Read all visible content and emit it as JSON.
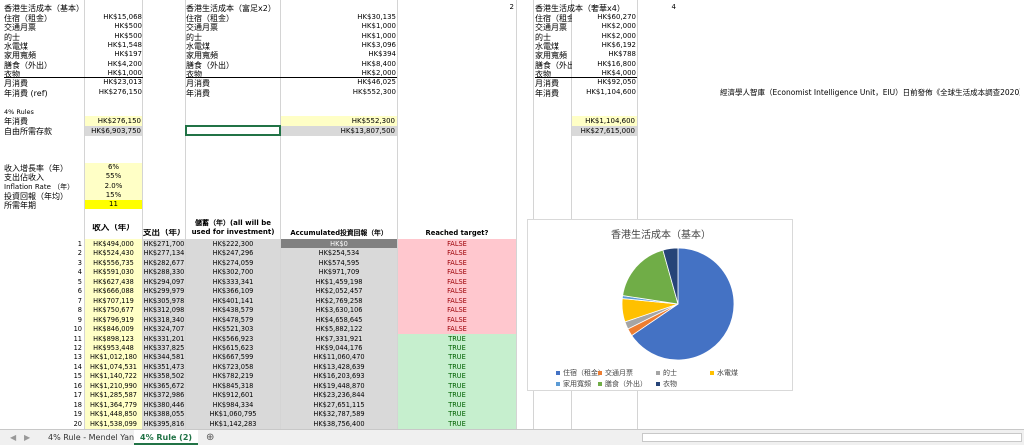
{
  "sheet": {
    "basic": {
      "title": "香港生活成本（基本）",
      "rows": [
        {
          "label": "住宿（租金）",
          "value": "HK$15,068"
        },
        {
          "label": "交通月票",
          "value": "HK$500"
        },
        {
          "label": "的士",
          "value": "HK$500"
        },
        {
          "label": "水電煤",
          "value": "HK$1,548"
        },
        {
          "label": "家用寬頻",
          "value": "HK$197"
        },
        {
          "label": "膳食（外出）",
          "value": "HK$4,200"
        },
        {
          "label": "衣物",
          "value": "HK$1,000"
        }
      ],
      "monthly_label": "月消費",
      "monthly_value": "HK$23,013",
      "yearly_label": "年消費 (ref)",
      "yearly_value": "HK$276,150"
    },
    "rich": {
      "title": "香港生活成本（富足x2）",
      "multiplier": "2",
      "rows": [
        {
          "label": "住宿（租金）",
          "value": "HK$30,135"
        },
        {
          "label": "交通月票",
          "value": "HK$1,000"
        },
        {
          "label": "的士",
          "value": "HK$1,000"
        },
        {
          "label": "水電煤",
          "value": "HK$3,096"
        },
        {
          "label": "家用寬頻",
          "value": "HK$394"
        },
        {
          "label": "膳食（外出）",
          "value": "HK$8,400"
        },
        {
          "label": "衣物",
          "value": "HK$2,000"
        }
      ],
      "monthly_label": "月消費",
      "monthly_value": "HK$46,025",
      "yearly_label": "年消費",
      "yearly_value": "HK$552,300"
    },
    "luxury": {
      "title": "香港生活成本（奢華x4）",
      "multiplier": "4",
      "rows": [
        {
          "label": "住宿（租金",
          "value": "HK$60,270"
        },
        {
          "label": "交通月票",
          "value": "HK$2,000"
        },
        {
          "label": "的士",
          "value": "HK$2,000"
        },
        {
          "label": "水電煤",
          "value": "HK$6,192"
        },
        {
          "label": "家用寬頻",
          "value": "HK$788"
        },
        {
          "label": "膳食（外出",
          "value": "HK$16,800"
        },
        {
          "label": "衣物",
          "value": "HK$4,000"
        }
      ],
      "monthly_label": "月消費",
      "monthly_value": "HK$92,050",
      "yearly_label": "年消費",
      "yearly_value": "HK$1,104,600"
    },
    "source_note": "經濟學人智庫（Economist Intelligence Unit，EIU）日前發佈《全球生活成本調查2020》",
    "rule4": {
      "heading": "4% Rules",
      "yearly_label": "年消費",
      "needed_label": "自由所需存款",
      "basic_yearly": "HK$276,150",
      "basic_needed": "HK$6,903,750",
      "rich_yearly": "HK$552,300",
      "rich_needed": "HK$13,807,500",
      "lux_yearly": "HK$1,104,600",
      "lux_needed": "HK$27,615,000"
    },
    "params": [
      {
        "label": "收入增長率（年）",
        "value": "6%"
      },
      {
        "label": "支出佔收入",
        "value": "55%"
      },
      {
        "label": "Inflation Rate （年）",
        "value": "2.0%"
      },
      {
        "label": "投資回報（年均）",
        "value": "15%"
      },
      {
        "label": "所需年期",
        "value": "11"
      }
    ],
    "table": {
      "headers": {
        "income": "收入（年）",
        "spend": "支出（年）",
        "save": "儲蓄（年）(all will be used for investment)",
        "accum": "Accumulated投資回報（年）",
        "reached": "Reached target?"
      },
      "rows": [
        [
          "1",
          "HK$494,000",
          "HK$271,700",
          "HK$222,300",
          "HK$0",
          "FALSE"
        ],
        [
          "2",
          "HK$524,430",
          "HK$277,134",
          "HK$247,296",
          "HK$254,534",
          "FALSE"
        ],
        [
          "3",
          "HK$556,735",
          "HK$282,677",
          "HK$274,059",
          "HK$574,595",
          "FALSE"
        ],
        [
          "4",
          "HK$591,030",
          "HK$288,330",
          "HK$302,700",
          "HK$971,709",
          "FALSE"
        ],
        [
          "5",
          "HK$627,438",
          "HK$294,097",
          "HK$333,341",
          "HK$1,459,198",
          "FALSE"
        ],
        [
          "6",
          "HK$666,088",
          "HK$299,979",
          "HK$366,109",
          "HK$2,052,457",
          "FALSE"
        ],
        [
          "7",
          "HK$707,119",
          "HK$305,978",
          "HK$401,141",
          "HK$2,769,258",
          "FALSE"
        ],
        [
          "8",
          "HK$750,677",
          "HK$312,098",
          "HK$438,579",
          "HK$3,630,106",
          "FALSE"
        ],
        [
          "9",
          "HK$796,919",
          "HK$318,340",
          "HK$478,579",
          "HK$4,658,645",
          "FALSE"
        ],
        [
          "10",
          "HK$846,009",
          "HK$324,707",
          "HK$521,303",
          "HK$5,882,122",
          "FALSE"
        ],
        [
          "11",
          "HK$898,123",
          "HK$331,201",
          "HK$566,923",
          "HK$7,331,921",
          "TRUE"
        ],
        [
          "12",
          "HK$953,448",
          "HK$337,825",
          "HK$615,623",
          "HK$9,044,176",
          "TRUE"
        ],
        [
          "13",
          "HK$1,012,180",
          "HK$344,581",
          "HK$667,599",
          "HK$11,060,470",
          "TRUE"
        ],
        [
          "14",
          "HK$1,074,531",
          "HK$351,473",
          "HK$723,058",
          "HK$13,428,639",
          "TRUE"
        ],
        [
          "15",
          "HK$1,140,722",
          "HK$358,502",
          "HK$782,219",
          "HK$16,203,693",
          "TRUE"
        ],
        [
          "16",
          "HK$1,210,990",
          "HK$365,672",
          "HK$845,318",
          "HK$19,448,870",
          "TRUE"
        ],
        [
          "17",
          "HK$1,285,587",
          "HK$372,986",
          "HK$912,601",
          "HK$23,236,844",
          "TRUE"
        ],
        [
          "18",
          "HK$1,364,779",
          "HK$380,446",
          "HK$984,334",
          "HK$27,651,115",
          "TRUE"
        ],
        [
          "19",
          "HK$1,448,850",
          "HK$388,055",
          "HK$1,060,795",
          "HK$32,787,589",
          "TRUE"
        ],
        [
          "20",
          "HK$1,538,099",
          "HK$395,816",
          "HK$1,142,283",
          "HK$38,756,400",
          "TRUE"
        ]
      ]
    }
  },
  "tabs": [
    {
      "label": "4% Rule - Mendel Yan",
      "active": false
    },
    {
      "label": "4% Rule (2)",
      "active": true
    }
  ],
  "add_sheet_glyph": "⊕",
  "chart_data": {
    "type": "pie",
    "title": "香港生活成本（基本）",
    "categories": [
      "住宿（租金）",
      "交通月票",
      "的士",
      "水電煤",
      "家用寬頻",
      "膳食（外出）",
      "衣物"
    ],
    "values": [
      15068,
      500,
      500,
      1548,
      197,
      4200,
      1000
    ],
    "colors": [
      "#4472c4",
      "#ed7d31",
      "#a5a5a5",
      "#ffc000",
      "#5b9bd5",
      "#70ad47",
      "#264478"
    ],
    "legend": "bottom"
  }
}
